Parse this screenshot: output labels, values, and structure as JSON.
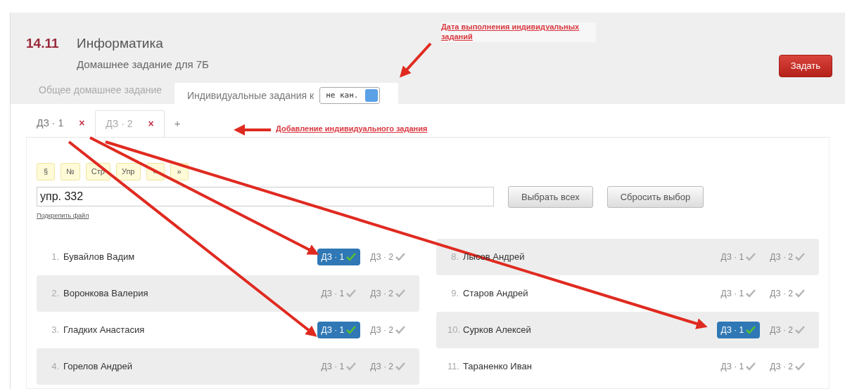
{
  "header": {
    "date": "14.11",
    "subject": "Информатика",
    "subtitle": "Домашнее задание для 7Б",
    "assign_button": "Задать"
  },
  "tabs": [
    {
      "label": "Общее домашнее задание",
      "selected": false
    },
    {
      "label": "Индивидуальные задания к",
      "selected": true
    }
  ],
  "date_select": {
    "value": "не кан."
  },
  "task_tabs": [
    {
      "label": "ДЗ · 1",
      "selected": true,
      "close": "×"
    },
    {
      "label": "ДЗ · 2",
      "selected": false,
      "close": "×"
    }
  ],
  "add_tab": "+",
  "toolbar": [
    "§",
    "№",
    "Стр",
    "Упр",
    "«",
    "»"
  ],
  "task_text": {
    "value": "упр. 332"
  },
  "attach_link": "Подкрепить файл",
  "select_all": "Выбрать всех",
  "reset_selection": "Сбросить выбор",
  "students": [
    [
      {
        "number": "1.",
        "name": "Бувайлов Вадим",
        "shaded": false,
        "tasks": [
          {
            "label": "ДЗ · 1",
            "selected": true
          },
          {
            "label": "ДЗ · 2",
            "selected": false
          }
        ]
      },
      {
        "number": "2.",
        "name": "Воронкова Валерия",
        "shaded": true,
        "tasks": [
          {
            "label": "ДЗ · 1",
            "selected": false
          },
          {
            "label": "ДЗ · 2",
            "selected": false
          }
        ]
      },
      {
        "number": "3.",
        "name": "Гладких Анастасия",
        "shaded": false,
        "tasks": [
          {
            "label": "ДЗ · 1",
            "selected": true
          },
          {
            "label": "ДЗ · 2",
            "selected": false
          }
        ]
      },
      {
        "number": "4.",
        "name": "Горелов Андрей",
        "shaded": true,
        "tasks": [
          {
            "label": "ДЗ · 1",
            "selected": false
          },
          {
            "label": "ДЗ · 2",
            "selected": false
          }
        ]
      }
    ],
    [
      {
        "number": "8.",
        "name": "Лысов Андрей",
        "shaded": true,
        "tasks": [
          {
            "label": "ДЗ · 1",
            "selected": false
          },
          {
            "label": "ДЗ · 2",
            "selected": false
          }
        ]
      },
      {
        "number": "9.",
        "name": "Старов Андрей",
        "shaded": false,
        "tasks": [
          {
            "label": "ДЗ · 1",
            "selected": false
          },
          {
            "label": "ДЗ · 2",
            "selected": false
          }
        ]
      },
      {
        "number": "10.",
        "name": "Сурков Алексей",
        "shaded": true,
        "tasks": [
          {
            "label": "ДЗ · 1",
            "selected": true
          },
          {
            "label": "ДЗ · 2",
            "selected": false
          }
        ]
      },
      {
        "number": "11.",
        "name": "Тараненко Иван",
        "shaded": false,
        "tasks": [
          {
            "label": "ДЗ · 1",
            "selected": false
          },
          {
            "label": "ДЗ · 2",
            "selected": false
          }
        ]
      }
    ]
  ],
  "annotations": [
    {
      "text": "Дата выполнения индивидуальных заданий"
    },
    {
      "text": "Добавление индивидуального задания"
    }
  ]
}
